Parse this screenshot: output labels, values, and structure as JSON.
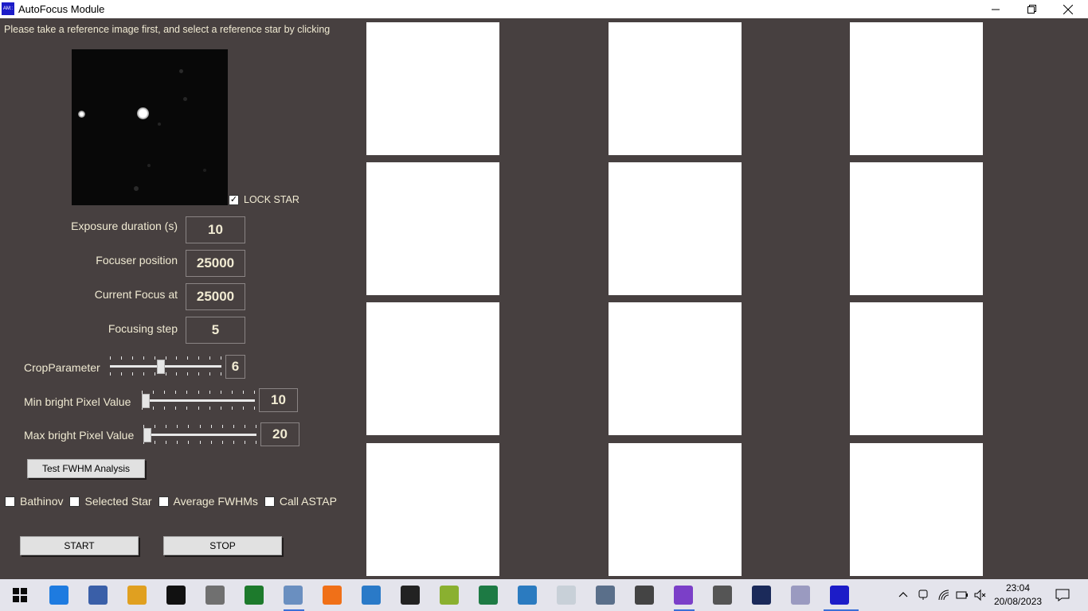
{
  "window": {
    "title": "AutoFocus Module",
    "icon_text": "AM::"
  },
  "instructions": "Please take a reference image first, and select a reference star by clicking",
  "lock_star": {
    "label": "LOCK STAR",
    "checked": true
  },
  "fields": {
    "exposure": {
      "label": "Exposure duration (s)",
      "value": "10"
    },
    "focuser_position": {
      "label": "Focuser position",
      "value": "25000"
    },
    "current_focus": {
      "label": "Current Focus at",
      "value": "25000"
    },
    "focusing_step": {
      "label": "Focusing step",
      "value": "5"
    }
  },
  "sliders": {
    "crop": {
      "label": "CropParameter",
      "value": "6",
      "level": 0.45
    },
    "min_bright": {
      "label": "Min bright Pixel Value",
      "value": "10",
      "level": 0.0
    },
    "max_bright": {
      "label": "Max bright Pixel Value",
      "value": "20",
      "level": 0.0
    }
  },
  "buttons": {
    "test_fwhm": "Test FWHM Analysis",
    "start": "START",
    "stop": "STOP"
  },
  "options": [
    {
      "label": "Bathinov",
      "checked": false
    },
    {
      "label": "Selected Star",
      "checked": false
    },
    {
      "label": "Average FWHMs",
      "checked": false
    },
    {
      "label": "Call ASTAP",
      "checked": false
    }
  ],
  "colors": {
    "background": "#474040",
    "label_text": "#f0ead2",
    "panel": "#ffffff",
    "taskbar": "#e4e4ec"
  },
  "taskbar": {
    "icons": [
      "windows-start-icon",
      "edge-icon",
      "device-manager-icon",
      "file-explorer-icon",
      "starfield-app-icon",
      "editor-app-icon",
      "media-app-icon",
      "satellite-app-icon",
      "blender-app-icon",
      "star-app-icon",
      "terminal-icon",
      "notepad-plus-icon",
      "excel-icon",
      "control-panel-icon",
      "network-app-icon",
      "calculator-icon",
      "keyboard-app-icon",
      "visual-studio-icon",
      "camera-app-icon",
      "night-sky-app-icon",
      "book-app-icon",
      "am-app-icon"
    ],
    "time": "23:04",
    "date": "20/08/2023"
  }
}
